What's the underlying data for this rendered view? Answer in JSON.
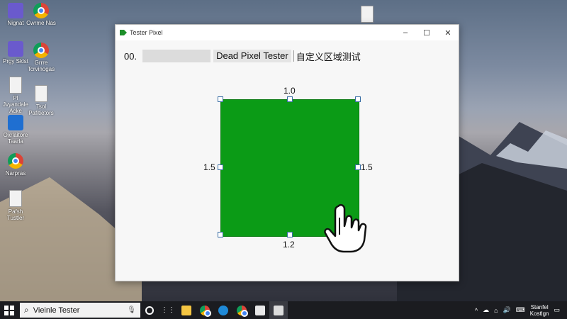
{
  "desktop": {
    "icons": [
      {
        "label": "Nignat",
        "icon": "app-icon"
      },
      {
        "label": "Cwrme Nas",
        "icon": "chrome-icon"
      },
      {
        "label": "Prgy Sklst",
        "icon": "app-icon"
      },
      {
        "label": "Grrre Tcrvinogas",
        "icon": "chrome-icon"
      },
      {
        "label": "Pl Jvyandale Acke",
        "icon": "document-icon"
      },
      {
        "label": "Tsol Pafitietors",
        "icon": "document-icon"
      },
      {
        "label": "Oxrlaitore Taarla",
        "icon": "app-icon"
      },
      {
        "label": "Narpras",
        "icon": "chrome-icon"
      },
      {
        "label": "Pafsh Tustler",
        "icon": "document-icon"
      }
    ]
  },
  "window": {
    "title": "Tester Pixel",
    "controls": {
      "minimize": "–",
      "maximize": "☐",
      "close": "✕"
    },
    "toolbar": {
      "prefix": "00.",
      "field_value": "",
      "app_title": "Dead Pixel Tester",
      "custom_region": "自定义区域测试"
    },
    "test_area": {
      "fill_color": "#0b9b16",
      "label_top": "1.0",
      "label_bottom": "1.2",
      "label_left": "1.5",
      "label_right": "1.5"
    }
  },
  "taskbar": {
    "search_text": "Vieinle Tester",
    "pinned": [
      "task-view-icon",
      "dots-icon",
      "file-explorer-icon",
      "chrome-icon",
      "edge-icon",
      "chrome-icon",
      "store-icon",
      "pixel-tester-icon"
    ],
    "tray": {
      "clock_line1": "Stanfel",
      "clock_line2": "Kostlgn"
    }
  }
}
